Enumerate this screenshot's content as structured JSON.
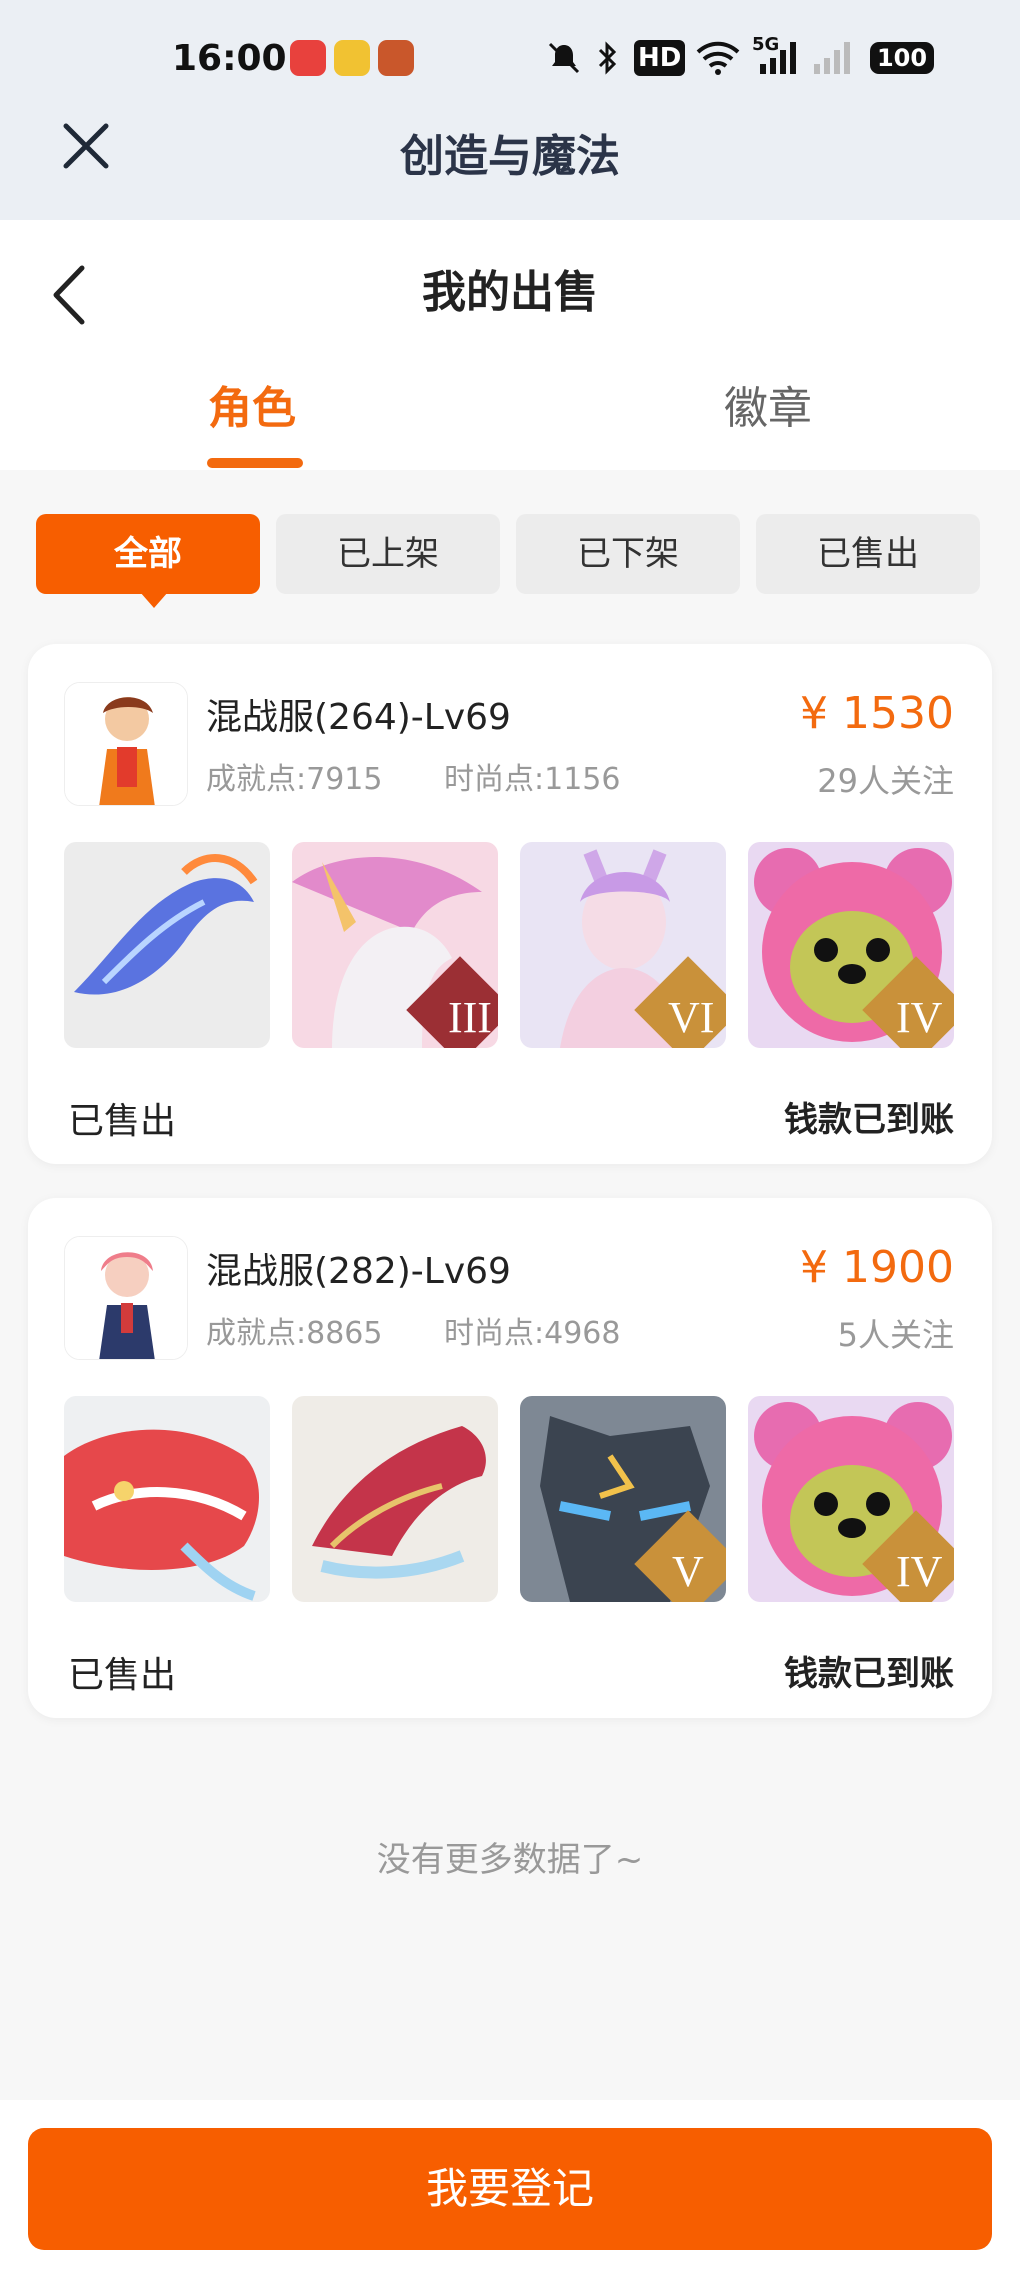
{
  "status_bar": {
    "time": "16:00",
    "hd_label": "HD",
    "net_label": "5G",
    "battery": "100"
  },
  "app_bar": {
    "title": "创造与魔法"
  },
  "page": {
    "title": "我的出售"
  },
  "tabs": [
    {
      "label": "角色",
      "active": true
    },
    {
      "label": "徽章",
      "active": false
    }
  ],
  "filters": [
    {
      "label": "全部",
      "active": true
    },
    {
      "label": "已上架",
      "active": false
    },
    {
      "label": "已下架",
      "active": false
    },
    {
      "label": "已售出",
      "active": false
    }
  ],
  "listings": [
    {
      "title": "混战服(264)-Lv69",
      "achievement": "成就点:7915",
      "fashion": "时尚点:1156",
      "price": "¥ 1530",
      "followers": "29人关注",
      "thumb_badges": [
        "",
        "III",
        "VI",
        "IV"
      ],
      "status": "已售出",
      "payment": "钱款已到账"
    },
    {
      "title": "混战服(282)-Lv69",
      "achievement": "成就点:8865",
      "fashion": "时尚点:4968",
      "price": "¥ 1900",
      "followers": "5人关注",
      "thumb_badges": [
        "",
        "",
        "V",
        "IV"
      ],
      "status": "已售出",
      "payment": "钱款已到账"
    }
  ],
  "footer": {
    "no_more": "没有更多数据了~",
    "register_label": "我要登记"
  },
  "colors": {
    "accent": "#f75e00",
    "price": "#f36a0f",
    "header_bg": "#ebeff4"
  }
}
